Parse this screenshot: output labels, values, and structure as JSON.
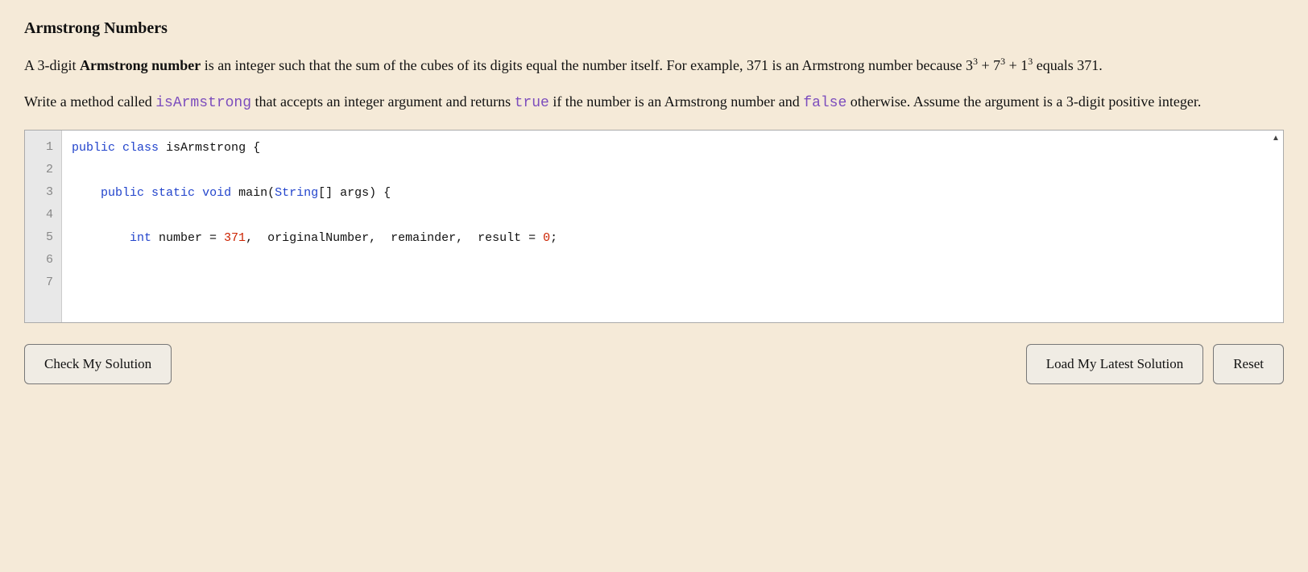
{
  "page": {
    "title": "Armstrong Numbers"
  },
  "description": {
    "paragraph1_parts": {
      "before": "A 3-digit ",
      "bold": "Armstrong number",
      "after": " is an integer such that the sum of the cubes of its digits equal the number itself. For example, 371 is an Armstrong number because 3",
      "sup1": "3",
      "mid1": " + 7",
      "sup2": "3",
      "mid2": " + 1",
      "sup3": "3",
      "end": " equals 371."
    },
    "paragraph2_parts": {
      "before": "Write a method called ",
      "method_name": "isArmstrong",
      "mid1": " that accepts an integer argument and returns ",
      "true_val": "true",
      "mid2": " if the number is an Armstrong number and ",
      "false_val": "false",
      "end": " otherwise. Assume the argument is a 3-digit positive integer."
    }
  },
  "editor": {
    "lines": [
      {
        "number": "1",
        "content_key": "line1"
      },
      {
        "number": "2",
        "content_key": "line2"
      },
      {
        "number": "3",
        "content_key": "line3"
      },
      {
        "number": "4",
        "content_key": "line4"
      },
      {
        "number": "5",
        "content_key": "line5"
      },
      {
        "number": "6",
        "content_key": "line6"
      },
      {
        "number": "7",
        "content_key": "line7_partial"
      }
    ]
  },
  "buttons": {
    "check": "Check My Solution",
    "load": "Load My Latest Solution",
    "reset": "Reset"
  }
}
